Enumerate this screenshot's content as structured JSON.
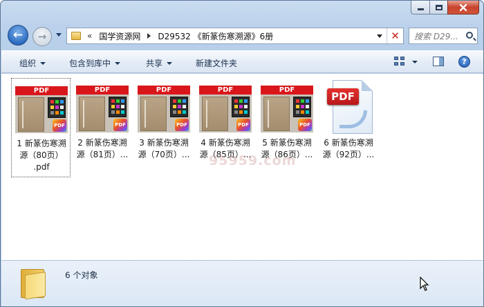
{
  "window": {
    "caption_buttons": [
      "minimize",
      "maximize",
      "close"
    ]
  },
  "nav": {
    "address_overflow": "«",
    "breadcrumb": [
      "国学资源网",
      "D29532 《新篆伤寒溯源》6册"
    ],
    "search_placeholder": "搜索 D29..."
  },
  "toolbar": {
    "organize": "组织",
    "include_in_library": "包含到库中",
    "share": "共享",
    "new_folder": "新建文件夹"
  },
  "files": [
    {
      "line1": "1 新篆伤寒溯",
      "line2": "源（80页）",
      "line3": ".pdf",
      "thumb_label": "PDF",
      "badge": "PDF",
      "selected": true
    },
    {
      "line1": "2 新篆伤寒溯",
      "line2": "源（81页）...",
      "thumb_label": "PDF",
      "badge": "PDF"
    },
    {
      "line1": "3 新篆伤寒溯",
      "line2": "源（70页）...",
      "thumb_label": "PDF",
      "badge": "PDF"
    },
    {
      "line1": "4 新篆伤寒溯",
      "line2": "源（85页）...",
      "thumb_label": "PDF",
      "badge": "PDF"
    },
    {
      "line1": "5 新篆伤寒溯",
      "line2": "源（86页）...",
      "thumb_label": "PDF",
      "badge": "PDF"
    },
    {
      "line1": "6 新篆伤寒溯",
      "line2": "源（92页）...",
      "thumb_label": "PDF"
    }
  ],
  "watermark": "95959.com",
  "details": {
    "count": "6 个对象"
  },
  "colors": {
    "pdf_red": "#d9171b",
    "window_frame": "#bcd2ec",
    "toolbar_text": "#1a3050"
  }
}
